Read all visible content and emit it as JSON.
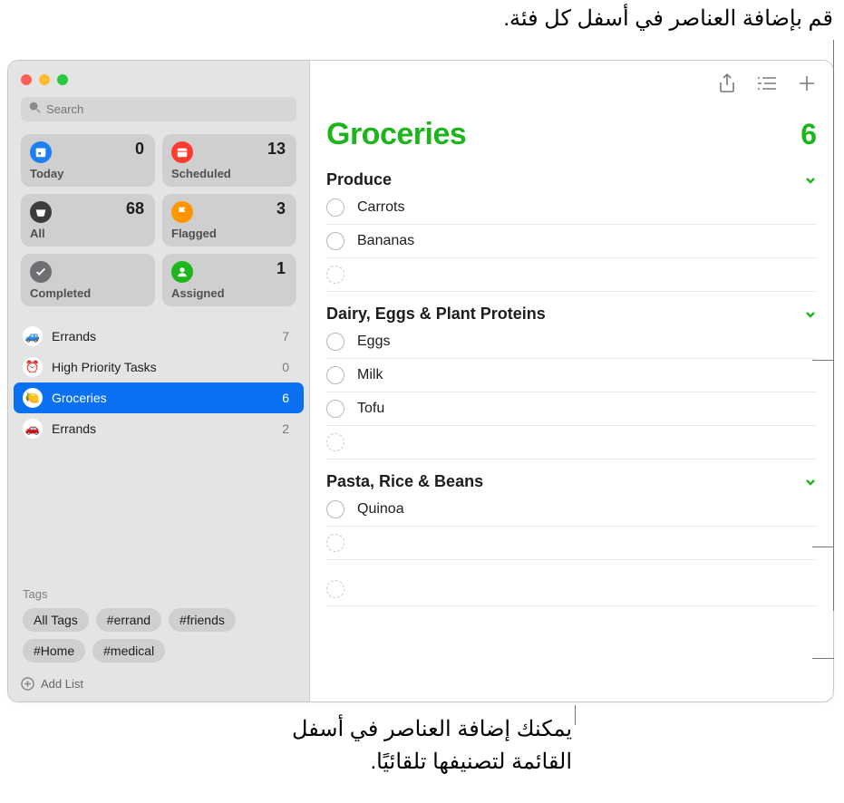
{
  "callouts": {
    "top": "قم بإضافة العناصر في أسفل كل فئة.",
    "bottom": "يمكنك إضافة العناصر في أسفل القائمة لتصنيفها تلقائيًا."
  },
  "search": {
    "placeholder": "Search"
  },
  "smartLists": [
    {
      "key": "today",
      "label": "Today",
      "count": "0",
      "bg": "#1d7ff2"
    },
    {
      "key": "scheduled",
      "label": "Scheduled",
      "count": "13",
      "bg": "#ff3b30"
    },
    {
      "key": "all",
      "label": "All",
      "count": "68",
      "bg": "#3c3c3c"
    },
    {
      "key": "flagged",
      "label": "Flagged",
      "count": "3",
      "bg": "#ff9500"
    },
    {
      "key": "completed",
      "label": "Completed",
      "count": "",
      "bg": "#6e6e73"
    },
    {
      "key": "assigned",
      "label": "Assigned",
      "count": "1",
      "bg": "#1db61d"
    }
  ],
  "lists": [
    {
      "name": "Errands",
      "count": "7",
      "emoji": "🚙",
      "selected": false
    },
    {
      "name": "High Priority Tasks",
      "count": "0",
      "emoji": "⏰",
      "selected": false
    },
    {
      "name": "Groceries",
      "count": "6",
      "emoji": "🍋",
      "selected": true
    },
    {
      "name": "Errands",
      "count": "2",
      "emoji": "🚗",
      "selected": false
    }
  ],
  "tagsTitle": "Tags",
  "tags": [
    "All Tags",
    "#errand",
    "#friends",
    "#Home",
    "#medical"
  ],
  "addList": "Add List",
  "listHeader": {
    "title": "Groceries",
    "count": "6"
  },
  "sections": [
    {
      "title": "Produce",
      "items": [
        "Carrots",
        "Bananas"
      ]
    },
    {
      "title": "Dairy, Eggs & Plant Proteins",
      "items": [
        "Eggs",
        "Milk",
        "Tofu"
      ]
    },
    {
      "title": "Pasta, Rice & Beans",
      "items": [
        "Quinoa"
      ]
    }
  ]
}
